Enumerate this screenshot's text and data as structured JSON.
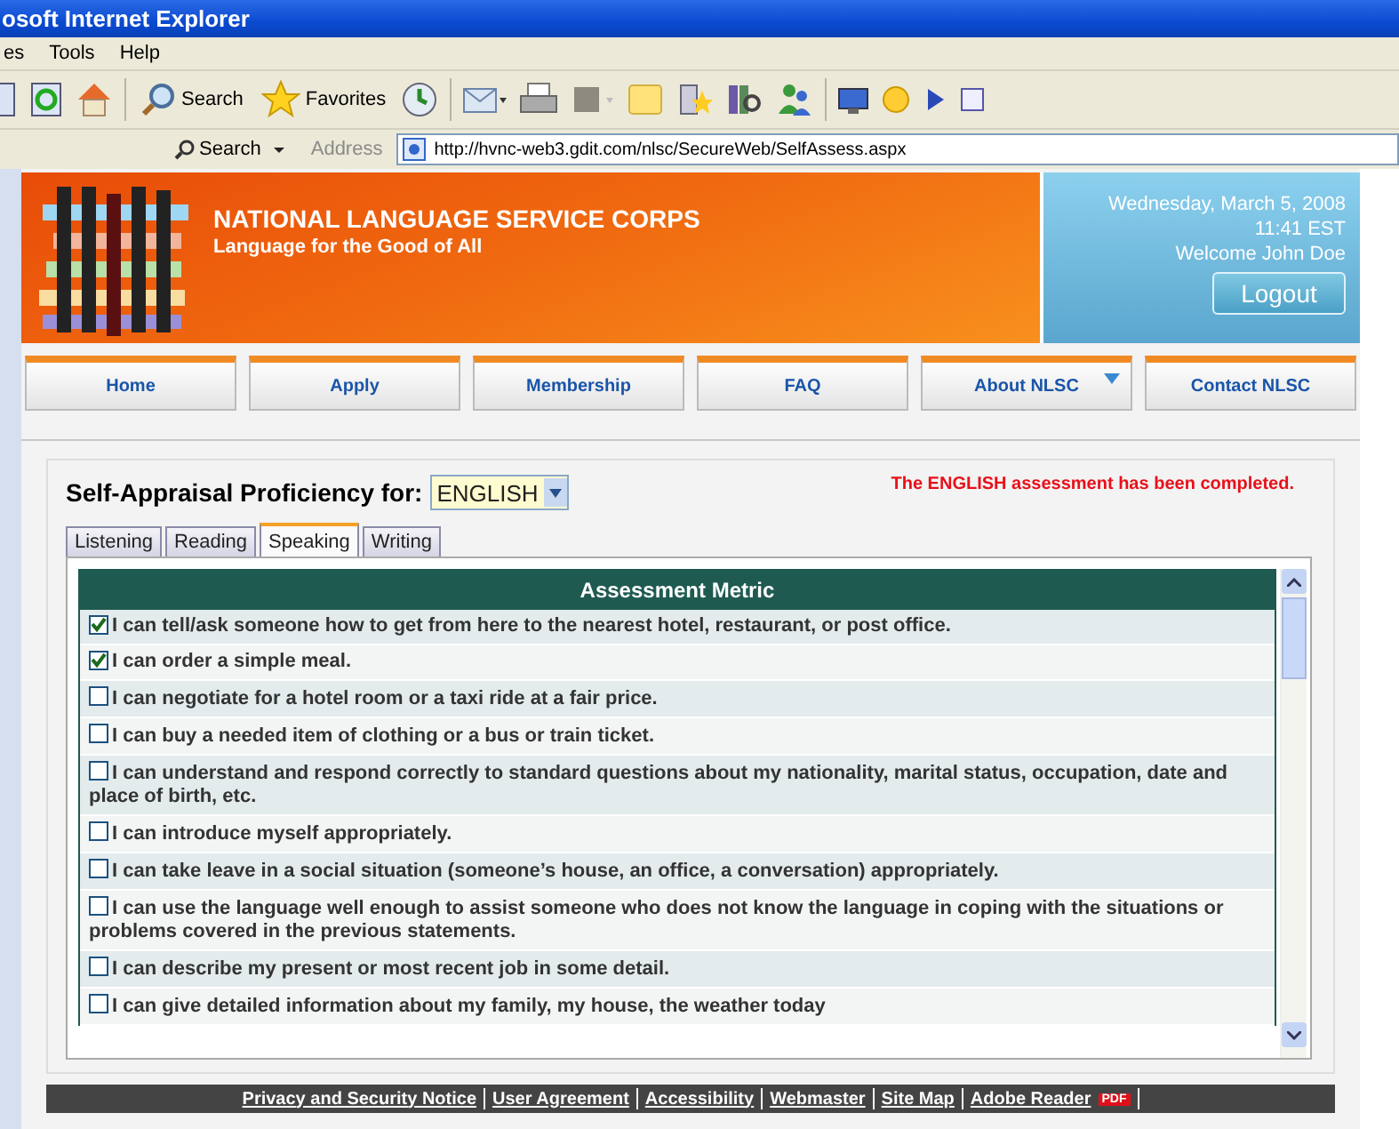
{
  "window": {
    "title": "osoft Internet Explorer"
  },
  "menu": [
    "es",
    "Tools",
    "Help"
  ],
  "toolbar": {
    "search_label": "Search",
    "favorites_label": "Favorites"
  },
  "address_bar": {
    "search_button": "Search",
    "address_label": "Address",
    "url": "http://hvnc-web3.gdit.com/nlsc/SecureWeb/SelfAssess.aspx"
  },
  "banner": {
    "title": "NATIONAL LANGUAGE SERVICE CORPS",
    "tagline": "Language for the Good of All",
    "date": "Wednesday, March 5, 2008",
    "time": "11:41 EST",
    "welcome": "Welcome John Doe",
    "logout": "Logout"
  },
  "nav": [
    {
      "label": "Home",
      "dropdown": false
    },
    {
      "label": "Apply",
      "dropdown": false
    },
    {
      "label": "Membership",
      "dropdown": false
    },
    {
      "label": "FAQ",
      "dropdown": false
    },
    {
      "label": "About NLSC",
      "dropdown": true
    },
    {
      "label": "Contact NLSC",
      "dropdown": false
    }
  ],
  "assessment": {
    "heading": "Self-Appraisal Proficiency for:",
    "language": "ENGLISH",
    "message": "The ENGLISH assessment has been completed.",
    "tabs": [
      {
        "label": "Listening",
        "selected": false
      },
      {
        "label": "Reading",
        "selected": false
      },
      {
        "label": "Speaking",
        "selected": true
      },
      {
        "label": "Writing",
        "selected": false
      }
    ],
    "table_header": "Assessment Metric",
    "items": [
      {
        "text": "I can tell/ask someone how to get from here to the nearest hotel, restaurant, or post office.",
        "checked": true
      },
      {
        "text": "I can order a simple meal.",
        "checked": true
      },
      {
        "text": "I can negotiate for a hotel room or a taxi ride at a fair price.",
        "checked": false
      },
      {
        "text": "I can buy a needed item of clothing or a bus or train ticket.",
        "checked": false
      },
      {
        "text": "I can understand and respond correctly to standard questions about my nationality, marital status, occupation, date and place of birth, etc.",
        "checked": false
      },
      {
        "text": "I can introduce myself appropriately.",
        "checked": false
      },
      {
        "text": "I can take leave in a social situation (someone’s house, an office, a conversation) appropriately.",
        "checked": false
      },
      {
        "text": "I can use the language well enough to assist someone who does not know the language in coping with the situations or problems covered in the previous statements.",
        "checked": false
      },
      {
        "text": "I can describe my present or most recent job in some detail.",
        "checked": false
      },
      {
        "text": "I can give detailed information about my family, my house, the weather today",
        "checked": false
      }
    ]
  },
  "footer": {
    "links": [
      "Privacy and Security Notice",
      "User Agreement",
      "Accessibility",
      "Webmaster",
      "Site Map",
      "Adobe Reader"
    ],
    "pdf_badge": "PDF"
  }
}
